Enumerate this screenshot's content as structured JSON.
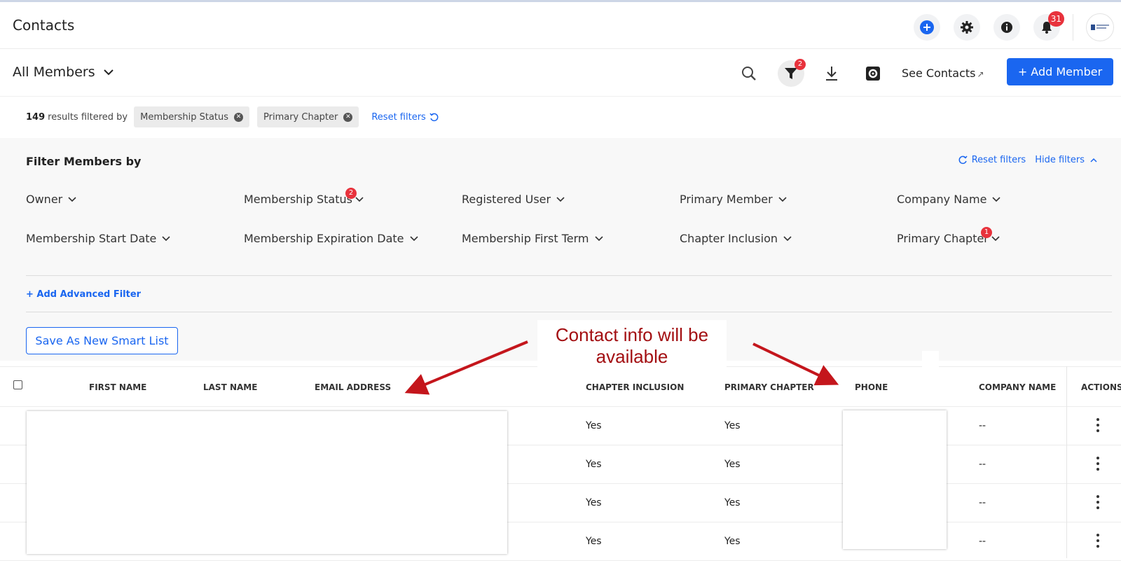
{
  "header": {
    "title": "Contacts",
    "notification_count": "31",
    "icons": [
      "add-circle-icon",
      "gear-icon",
      "info-icon",
      "bell-icon",
      "avatar"
    ]
  },
  "subbar": {
    "list_name": "All Members",
    "filter_count": "2",
    "see_contacts": "See Contacts",
    "add_member": "+ Add Member"
  },
  "results": {
    "count": "149",
    "text": "results filtered by",
    "chips": [
      "Membership Status",
      "Primary Chapter"
    ],
    "reset": "Reset filters"
  },
  "filter_panel": {
    "title": "Filter Members by",
    "reset": "Reset filters",
    "hide": "Hide filters",
    "filters": [
      {
        "label": "Owner",
        "badge": ""
      },
      {
        "label": "Membership Status",
        "badge": "2"
      },
      {
        "label": "Registered User",
        "badge": ""
      },
      {
        "label": "Primary Member",
        "badge": ""
      },
      {
        "label": "Company Name",
        "badge": ""
      },
      {
        "label": "Membership Start Date",
        "badge": ""
      },
      {
        "label": "Membership Expiration Date",
        "badge": ""
      },
      {
        "label": "Membership First Term",
        "badge": ""
      },
      {
        "label": "Chapter Inclusion",
        "badge": ""
      },
      {
        "label": "Primary Chapter",
        "badge": "1"
      }
    ],
    "advanced": "+ Add Advanced Filter",
    "save_smart_list": "Save As New Smart List"
  },
  "table": {
    "columns": [
      "FIRST NAME",
      "LAST NAME",
      "EMAIL ADDRESS",
      "CHAPTER INCLUSION",
      "PRIMARY CHAPTER",
      "PHONE",
      "COMPANY NAME",
      "ACTIONS"
    ],
    "rows": [
      {
        "chapter_inclusion": "Yes",
        "primary_chapter": "Yes",
        "company": "--"
      },
      {
        "chapter_inclusion": "Yes",
        "primary_chapter": "Yes",
        "company": "--"
      },
      {
        "chapter_inclusion": "Yes",
        "primary_chapter": "Yes",
        "company": "--"
      },
      {
        "chapter_inclusion": "Yes",
        "primary_chapter": "Yes",
        "company": "--"
      }
    ]
  },
  "annotation": {
    "line1": "Contact info will be",
    "line2": "available",
    "color": "#a30f12"
  },
  "colors": {
    "accent": "#1a66f0",
    "badge": "#e8323c"
  }
}
